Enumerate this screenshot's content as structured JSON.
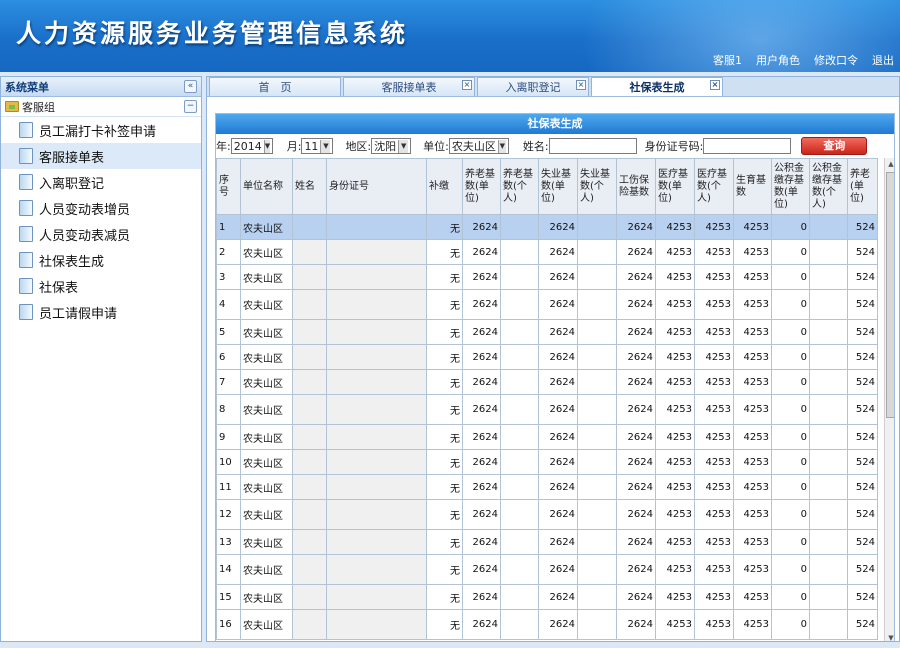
{
  "header": {
    "title": "人力资源服务业务管理信息系统",
    "links": [
      "客服1",
      "用户角色",
      "修改口令",
      "退出"
    ]
  },
  "sidebar": {
    "title": "系统菜单",
    "collapse_glyph": "«",
    "group": {
      "label": "客服组",
      "collapse_glyph": "−"
    },
    "items": [
      {
        "label": "员工漏打卡补签申请"
      },
      {
        "label": "客服接单表"
      },
      {
        "label": "入离职登记"
      },
      {
        "label": "人员变动表增员"
      },
      {
        "label": "人员变动表减员"
      },
      {
        "label": "社保表生成"
      },
      {
        "label": "社保表"
      },
      {
        "label": "员工请假申请"
      }
    ],
    "active_index": 1
  },
  "tabs": [
    {
      "label": "首　页",
      "closable": false
    },
    {
      "label": "客服接单表",
      "closable": true
    },
    {
      "label": "入离职登记",
      "closable": true
    },
    {
      "label": "社保表生成",
      "closable": true,
      "active": true
    }
  ],
  "panel": {
    "title": "社保表生成",
    "filters": {
      "year_label": "年:",
      "year_value": "2014",
      "month_label": "月:",
      "month_value": "11",
      "region_label": "地区:",
      "region_value": "沈阳",
      "unit_label": "单位:",
      "unit_value": "农夫山区",
      "name_label": "姓名:",
      "name_value": "",
      "idno_label": "身份证号码:",
      "idno_value": "",
      "search_label": "查询"
    },
    "columns": [
      "序号",
      "单位名称",
      "姓名",
      "身份证号",
      "补缴",
      "养老基数(单位)",
      "养老基数(个人)",
      "失业基数(单位)",
      "失业基数(个人)",
      "工伤保险基数",
      "医疗基数(单位)",
      "医疗基数(个人)",
      "生育基数",
      "公积金缴存基数(单位)",
      "公积金缴存基数(个人)",
      "养老(单位)"
    ],
    "rows": [
      [
        "1",
        "农夫山区",
        "",
        "",
        "无",
        "2624",
        "",
        "2624",
        "",
        "2624",
        "4253",
        "4253",
        "4253",
        "0",
        "",
        "524"
      ],
      [
        "2",
        "农夫山区",
        "",
        "",
        "无",
        "2624",
        "",
        "2624",
        "",
        "2624",
        "4253",
        "4253",
        "4253",
        "0",
        "",
        "524"
      ],
      [
        "3",
        "农夫山区",
        "",
        "",
        "无",
        "2624",
        "",
        "2624",
        "",
        "2624",
        "4253",
        "4253",
        "4253",
        "0",
        "",
        "524"
      ],
      [
        "4",
        "农夫山区",
        "",
        "",
        "无",
        "2624",
        "",
        "2624",
        "",
        "2624",
        "4253",
        "4253",
        "4253",
        "0",
        "",
        "524"
      ],
      [
        "5",
        "农夫山区",
        "",
        "",
        "无",
        "2624",
        "",
        "2624",
        "",
        "2624",
        "4253",
        "4253",
        "4253",
        "0",
        "",
        "524"
      ],
      [
        "6",
        "农夫山区",
        "",
        "",
        "无",
        "2624",
        "",
        "2624",
        "",
        "2624",
        "4253",
        "4253",
        "4253",
        "0",
        "",
        "524"
      ],
      [
        "7",
        "农夫山区",
        "",
        "",
        "无",
        "2624",
        "",
        "2624",
        "",
        "2624",
        "4253",
        "4253",
        "4253",
        "0",
        "",
        "524"
      ],
      [
        "8",
        "农夫山区",
        "",
        "",
        "无",
        "2624",
        "",
        "2624",
        "",
        "2624",
        "4253",
        "4253",
        "4253",
        "0",
        "",
        "524"
      ],
      [
        "9",
        "农夫山区",
        "",
        "",
        "无",
        "2624",
        "",
        "2624",
        "",
        "2624",
        "4253",
        "4253",
        "4253",
        "0",
        "",
        "524"
      ],
      [
        "10",
        "农夫山区",
        "",
        "",
        "无",
        "2624",
        "",
        "2624",
        "",
        "2624",
        "4253",
        "4253",
        "4253",
        "0",
        "",
        "524"
      ],
      [
        "11",
        "农夫山区",
        "",
        "",
        "无",
        "2624",
        "",
        "2624",
        "",
        "2624",
        "4253",
        "4253",
        "4253",
        "0",
        "",
        "524"
      ],
      [
        "12",
        "农夫山区",
        "",
        "",
        "无",
        "2624",
        "",
        "2624",
        "",
        "2624",
        "4253",
        "4253",
        "4253",
        "0",
        "",
        "524"
      ],
      [
        "13",
        "农夫山区",
        "",
        "",
        "无",
        "2624",
        "",
        "2624",
        "",
        "2624",
        "4253",
        "4253",
        "4253",
        "0",
        "",
        "524"
      ],
      [
        "14",
        "农夫山区",
        "",
        "",
        "无",
        "2624",
        "",
        "2624",
        "",
        "2624",
        "4253",
        "4253",
        "4253",
        "0",
        "",
        "524"
      ],
      [
        "15",
        "农夫山区",
        "",
        "",
        "无",
        "2624",
        "",
        "2624",
        "",
        "2624",
        "4253",
        "4253",
        "4253",
        "0",
        "",
        "524"
      ],
      [
        "16",
        "农夫山区",
        "",
        "",
        "无",
        "2624",
        "",
        "2624",
        "",
        "2624",
        "4253",
        "4253",
        "4253",
        "0",
        "",
        "524"
      ]
    ],
    "selected_row": 0
  }
}
